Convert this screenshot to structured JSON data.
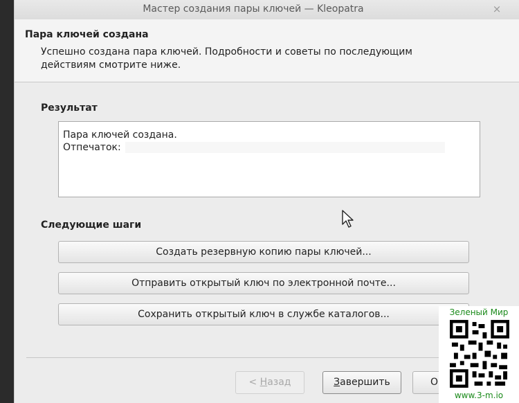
{
  "window": {
    "title": "Мастер создания пары ключей — Kleopatra",
    "close_glyph": "×"
  },
  "header": {
    "title": "Пара ключей создана",
    "description": "Успешно создана пара ключей. Подробности и советы по последующим действиям смотрите ниже."
  },
  "result": {
    "section_title": "Результат",
    "line1": "Пара ключей создана.",
    "fingerprint_label": "Отпечаток:"
  },
  "next_steps": {
    "section_title": "Следующие шаги",
    "buttons": [
      "Создать резервную копию пары ключей...",
      "Отправить открытый ключ по электронной почте...",
      "Сохранить открытый ключ в службе каталогов..."
    ]
  },
  "footer": {
    "back_label_prefix": "< ",
    "back_mnemonic": "Н",
    "back_label_rest": "азад",
    "finish_mnemonic": "З",
    "finish_label_rest": "авершить",
    "cancel_label": "О"
  },
  "watermark": {
    "top_text": "Зеленый Мир",
    "bottom_text": "www.3-m.io"
  },
  "icons": {
    "cursor": "mouse-pointer-icon",
    "qr": "qr-code-icon"
  }
}
